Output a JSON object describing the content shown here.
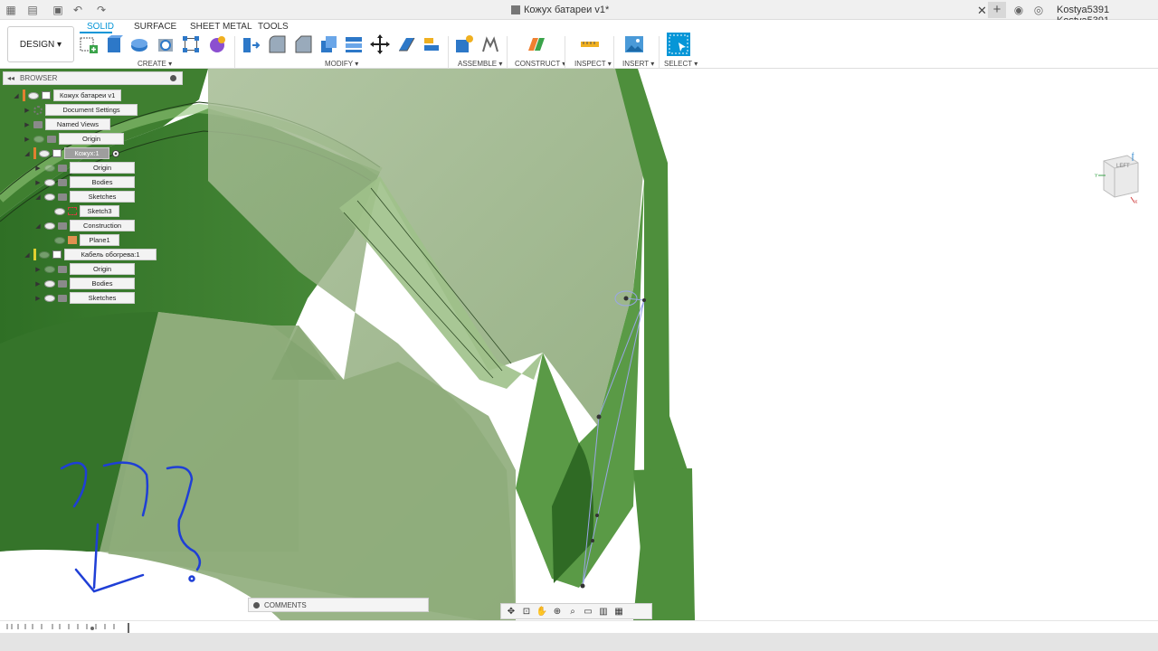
{
  "window": {
    "title": "Кожух батареи v1*",
    "user": "Kostya5391 Kostya5391",
    "icons": [
      "grid-icon",
      "file-icon",
      "save-icon",
      "undo-icon",
      "redo-icon",
      "close-icon",
      "plus-icon",
      "job-status-icon",
      "help-icon"
    ]
  },
  "toolbar": {
    "workspace_button": "DESIGN ▾",
    "tabs": [
      "SOLID",
      "SURFACE",
      "SHEET METAL",
      "TOOLS"
    ],
    "active_tab": "SOLID",
    "groups": {
      "create": "CREATE ▾",
      "modify": "MODIFY ▾",
      "assemble": "ASSEMBLE ▾",
      "construct": "CONSTRUCT ▾",
      "inspect": "INSPECT ▾",
      "insert": "INSERT ▾",
      "select": "SELECT ▾"
    },
    "accent": "#0696d7"
  },
  "browser": {
    "title": "BROWSER",
    "nodes": [
      {
        "label": "Кожух батареи v1"
      },
      {
        "label": "Document Settings"
      },
      {
        "label": "Named Views"
      },
      {
        "label": "Origin"
      },
      {
        "label": "Кожух:1"
      },
      {
        "label": "Origin"
      },
      {
        "label": "Bodies"
      },
      {
        "label": "Sketches"
      },
      {
        "label": "Sketch3"
      },
      {
        "label": "Construction"
      },
      {
        "label": "Plane1"
      },
      {
        "label": "Кабель обогрева:1"
      },
      {
        "label": "Origin"
      },
      {
        "label": "Bodies"
      },
      {
        "label": "Sketches"
      }
    ]
  },
  "viewcube": {
    "face": "LEFT"
  },
  "comments": {
    "label": "COMMENTS"
  },
  "colors": {
    "model_green": "#4e8f3c",
    "model_transparent": "#8fb07a",
    "annotation_blue": "#1f3fd6"
  }
}
